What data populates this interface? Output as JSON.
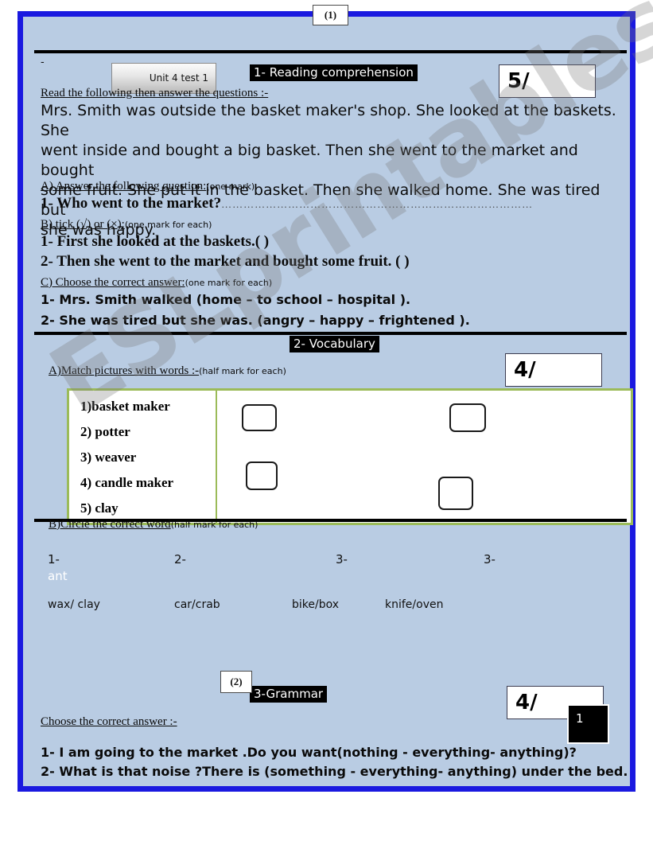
{
  "page": {
    "chip_top": "(1)",
    "chip_bottom": "(2)",
    "dash": "-",
    "unit_button_label": "Unit 4  test 1",
    "black_tag": "1",
    "bg_color": "#b9cce3",
    "border_color": "#1a19e0",
    "match_box_border_color": "#9bbb59"
  },
  "watermark": {
    "text": "ESLprintables.com"
  },
  "sections": {
    "reading": {
      "label": "1- Reading comprehension",
      "score": "5/",
      "instruction": "Read the following then answer the questions :-",
      "passage_lines": [
        "Mrs. Smith was outside the basket maker's shop. She looked at the baskets. She",
        "went inside and bought a big basket. Then she went to the market and bought",
        "some fruit. She put  it in the basket. Then she walked home. She was tired but",
        "she was happy."
      ],
      "part_a": {
        "heading": "A)  Answer the following question:",
        "mark_note": "(one mark)",
        "questions": [
          {
            "number": "1- Who went to the market?",
            "dots": "…………………………………………………………………………"
          }
        ]
      },
      "part_b": {
        "heading": "B)  tick (√) or (×):",
        "mark_note": "(one mark for each)",
        "questions": [
          "1- First she looked at the baskets.(   )",
          "2-  Then she went to the market and bought some fruit.  (   )"
        ]
      },
      "part_c": {
        "heading": "C)  Choose the correct answer:",
        "mark_note": " (one mark for each)",
        "questions": [
          "1-  Mrs. Smith walked  (home – to school – hospital ).",
          "2- She was tired but she was.  (angry – happy – frightened )."
        ]
      }
    },
    "vocabulary": {
      "label": "2- Vocabulary",
      "score": "4/",
      "part_a": {
        "heading": "A)Match pictures with words :-",
        "mark_note": "(half mark for each)",
        "words": [
          "1)basket maker",
          "2) potter",
          "3)  weaver",
          "4)  candle maker",
          "5)  clay"
        ]
      },
      "part_b": {
        "heading": "B)Circle the correct word",
        "mark_note": " (half mark for each)",
        "items": [
          {
            "number": "1-",
            "label": "ant",
            "options": "wax/ clay"
          },
          {
            "number": "2-",
            "label": "",
            "options": "car/crab"
          },
          {
            "number": "3-",
            "label": "",
            "options": "bike/box"
          },
          {
            "number": "3-",
            "label": "",
            "options": "knife/oven"
          }
        ]
      }
    },
    "grammar": {
      "label": "3-Grammar",
      "score": "4/",
      "instruction": "Choose the correct answer :-",
      "questions": [
        "1- I am going to the market .Do you want(nothing - everything-  anything)?",
        "2- What is that noise ?There is (something - everything-  anything) under the bed."
      ]
    }
  }
}
